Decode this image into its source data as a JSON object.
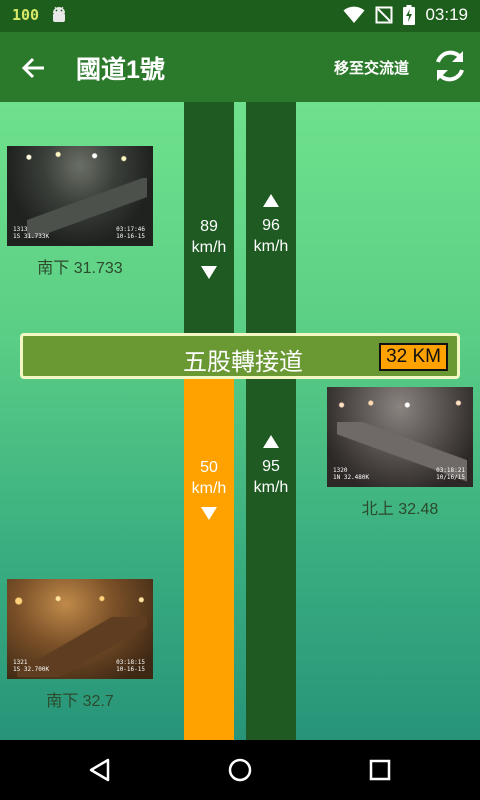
{
  "status_bar": {
    "battery_level": "100",
    "time": "03:19"
  },
  "toolbar": {
    "title": "國道1號",
    "interchange_label": "移至交流道"
  },
  "lanes": {
    "upper_south_speed": "89",
    "upper_north_speed": "96",
    "lower_south_speed": "50",
    "lower_north_speed": "95",
    "unit": "km/h"
  },
  "station": {
    "name": "五股轉接道",
    "km": "32 KM"
  },
  "cameras": [
    {
      "caption": "南下  31.733",
      "osd_id": "1313",
      "osd_km": "1S 31.733K",
      "osd_time": "03:17:46",
      "osd_date": "10-16-15"
    },
    {
      "caption": "北上  32.48",
      "osd_id": "1320",
      "osd_km": "1N 32.480K",
      "osd_time": "03:18:21",
      "osd_date": "10/16/15"
    },
    {
      "caption": "南下  32.7",
      "osd_id": "1321",
      "osd_km": "1S 32.700K",
      "osd_time": "03:18:15",
      "osd_date": "10-16-15"
    }
  ],
  "colors": {
    "status_bar": "#1d5e1d",
    "toolbar": "#2b7a2b",
    "lane_dark_green": "#1e5a22",
    "lane_orange": "#ffa200",
    "station_bar": "#6a9933"
  },
  "icons": {
    "back": "arrow-left-icon",
    "refresh": "refresh-icon",
    "android": "android-icon",
    "wifi": "wifi-icon",
    "signal": "no-signal-icon",
    "battery": "battery-charging-icon"
  }
}
